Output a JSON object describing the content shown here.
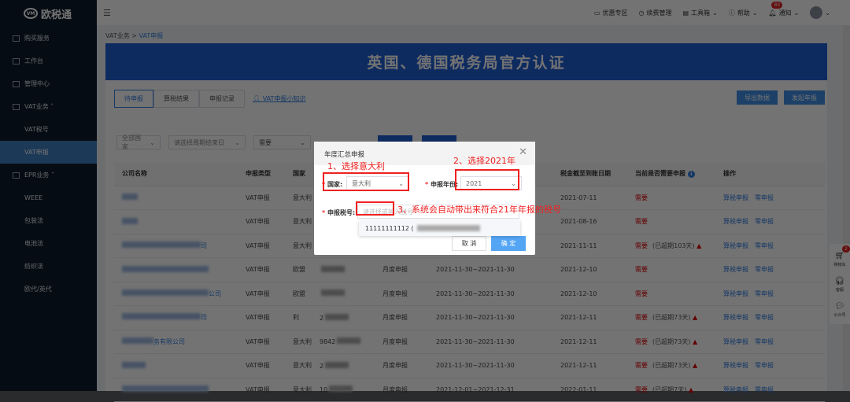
{
  "brand": "欧税通",
  "sidebar": {
    "items": [
      {
        "label": "购买服务"
      },
      {
        "label": "工作台"
      },
      {
        "label": "管理中心"
      },
      {
        "label": "VAT业务"
      },
      {
        "label": "VAT税号"
      },
      {
        "label": "VAT申报"
      },
      {
        "label": "EPR业务"
      },
      {
        "label": "WEEE"
      },
      {
        "label": "包装法"
      },
      {
        "label": "电池法"
      },
      {
        "label": "纺织法"
      },
      {
        "label": "欧代/英代"
      }
    ]
  },
  "topbar": {
    "items": [
      "优惠专区",
      "续费管理",
      "工具箱",
      "帮助",
      "通知"
    ],
    "notify_count": "83"
  },
  "breadcrumb": {
    "parent": "VAT业务",
    "sep": ">",
    "current": "VAT申报"
  },
  "banner": "英国、德国税务局官方认证",
  "tabs": [
    "待申报",
    "算税结果",
    "申报记录"
  ],
  "guide_link": "VAT申报小知识",
  "buttons": {
    "export": "导出数据",
    "annual": "发起年报"
  },
  "filters": {
    "country": "全部国家",
    "period_end": "请选择周期结束日",
    "need": "需要"
  },
  "table": {
    "headers": [
      "公司名称",
      "申报类型",
      "国家",
      "",
      "",
      "",
      "税金截至到账日期",
      "当前是否需要申报",
      "操作"
    ],
    "rows": [
      {
        "company": "",
        "type": "VAT申报",
        "country": "意大利",
        "taxno": "",
        "cycle": "",
        "period": "",
        "due": "2021-07-11",
        "need": "需要",
        "overdue": ""
      },
      {
        "company": "",
        "type": "VAT申报",
        "country": "意大利",
        "taxno": "",
        "cycle": "",
        "period": "",
        "due": "2021-08-16",
        "need": "需要",
        "overdue": ""
      },
      {
        "company": "司",
        "type": "VAT申报",
        "country": "意大利",
        "taxno": "",
        "cycle": "",
        "period": "",
        "due": "2021-11-11",
        "need": "需要",
        "overdue": "(已超期103天)"
      },
      {
        "company": "",
        "type": "VAT申报",
        "country": "欧盟",
        "taxno": "",
        "cycle": "月度申报",
        "period": "2021-11-30~2021-11-30",
        "due": "2021-12-10",
        "need": "需要",
        "overdue": ""
      },
      {
        "company": "公司",
        "type": "VAT申报",
        "country": "欧盟",
        "taxno": "",
        "cycle": "月度申报",
        "period": "2021-11-30~2021-11-30",
        "due": "2021-12-10",
        "need": "需要",
        "overdue": ""
      },
      {
        "company": "司",
        "type": "VAT申报",
        "country": "利",
        "taxno": "2",
        "cycle": "月度申报",
        "period": "2021-11-30~2021-11-30",
        "due": "2021-12-11",
        "need": "需要",
        "overdue": "(已超期73天)"
      },
      {
        "company": "务有限公司",
        "type": "VAT申报",
        "country": "意大利",
        "taxno": "9842",
        "cycle": "月度申报",
        "period": "2021-11-30~2021-11-30",
        "due": "2021-12-11",
        "need": "需要",
        "overdue": "(已超期73天)"
      },
      {
        "company": "",
        "type": "VAT申报",
        "country": "意大利",
        "taxno": "2",
        "cycle": "月度申报",
        "period": "2021-11-30~2021-11-30",
        "due": "2021-12-11",
        "need": "需要",
        "overdue": "(已超期73天)"
      },
      {
        "company": "",
        "type": "VAT申报",
        "country": "意大利",
        "taxno": "10",
        "cycle": "月度申报",
        "period": "2021-12-01~2021-12-31",
        "due": "2022-01-11",
        "need": "需要",
        "overdue": "(已超期7天)"
      }
    ],
    "actions": [
      "算税申报",
      "零申报"
    ]
  },
  "float": {
    "cart": "购物车",
    "cart_count": "2",
    "service": "客服",
    "wechat": "公众号"
  },
  "modal": {
    "title": "年度汇总申报",
    "country_label": "国家:",
    "country_value": "意大利",
    "year_label": "申报年份:",
    "year_value": "2021",
    "taxno_label": "申报税号:",
    "taxno_placeholder": "请选择或输入税号",
    "option": "11111111112 (",
    "cancel": "取 消",
    "ok": "确 定"
  },
  "annotations": [
    "1、选择意大利",
    "2、选择2021年",
    "3、系统会自动带出来符合21年年报的税号"
  ]
}
